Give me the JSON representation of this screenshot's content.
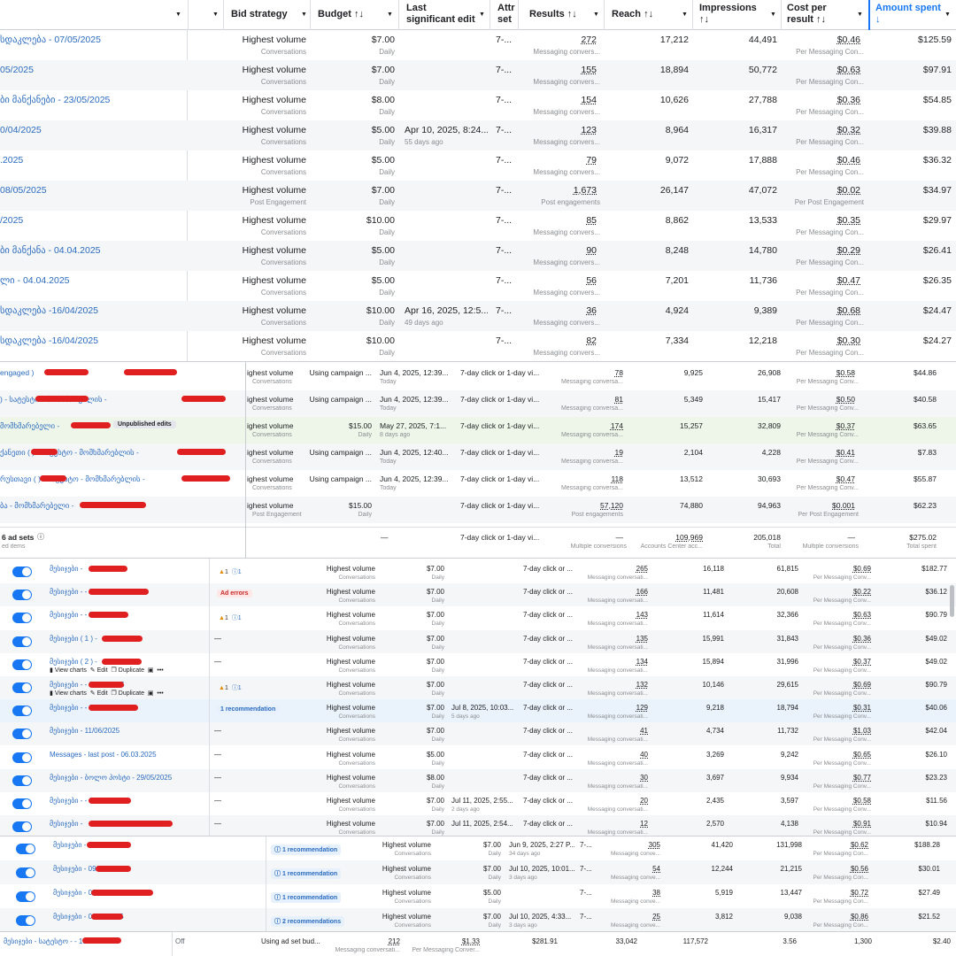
{
  "header": {
    "bid_strategy": "Bid strategy",
    "budget": "Budget ↑↓",
    "last_edit": "Last significant edit",
    "attribution": "Attr set",
    "results": "Results ↑↓",
    "reach": "Reach ↑↓",
    "impressions": "Impressions ↑↓",
    "cost_per_result": "Cost per result ↑↓",
    "amount_spent": "Amount spent ↓"
  },
  "section1": {
    "rows": [
      {
        "name": "სდაკლება - 07/05/2025",
        "bid": "Highest volume",
        "bid_sub": "Conversations",
        "budget": "$7.00",
        "budget_sub": "Daily",
        "edit": "",
        "edit_sub": "",
        "attr": "7-...",
        "results": "272",
        "results_sub": "Messaging convers...",
        "reach": "17,212",
        "impr": "44,491",
        "cpr": "$0.46",
        "cpr_sub": "Per Messaging Con...",
        "spent": "$125.59"
      },
      {
        "name": "05/2025",
        "bid": "Highest volume",
        "bid_sub": "Conversations",
        "budget": "$7.00",
        "budget_sub": "Daily",
        "edit": "",
        "edit_sub": "",
        "attr": "7-...",
        "results": "155",
        "results_sub": "Messaging convers...",
        "reach": "18,894",
        "impr": "50,772",
        "cpr": "$0.63",
        "cpr_sub": "Per Messaging Con...",
        "spent": "$97.91"
      },
      {
        "name": "ბი მანქანები - 23/05/2025",
        "bid": "Highest volume",
        "bid_sub": "Conversations",
        "budget": "$8.00",
        "budget_sub": "Daily",
        "edit": "",
        "edit_sub": "",
        "attr": "7-...",
        "results": "154",
        "results_sub": "Messaging convers...",
        "reach": "10,626",
        "impr": "27,788",
        "cpr": "$0.36",
        "cpr_sub": "Per Messaging Con...",
        "spent": "$54.85"
      },
      {
        "name": "0/04/2025",
        "bid": "Highest volume",
        "bid_sub": "Conversations",
        "budget": "$5.00",
        "budget_sub": "Daily",
        "edit": "Apr 10, 2025, 8:24...",
        "edit_sub": "55 days ago",
        "attr": "7-...",
        "results": "123",
        "results_sub": "Messaging convers...",
        "reach": "8,964",
        "impr": "16,317",
        "cpr": "$0.32",
        "cpr_sub": "Per Messaging Con...",
        "spent": "$39.88"
      },
      {
        "name": ".2025",
        "bid": "Highest volume",
        "bid_sub": "Conversations",
        "budget": "$5.00",
        "budget_sub": "Daily",
        "edit": "",
        "edit_sub": "",
        "attr": "7-...",
        "results": "79",
        "results_sub": "Messaging convers...",
        "reach": "9,072",
        "impr": "17,888",
        "cpr": "$0.46",
        "cpr_sub": "Per Messaging Con...",
        "spent": "$36.32"
      },
      {
        "name": "08/05/2025",
        "bid": "Highest volume",
        "bid_sub": "Post Engagement",
        "budget": "$7.00",
        "budget_sub": "Daily",
        "edit": "",
        "edit_sub": "",
        "attr": "7-...",
        "results": "1,673",
        "results_sub": "Post engagements",
        "reach": "26,147",
        "impr": "47,072",
        "cpr": "$0.02",
        "cpr_sub": "Per Post Engagement",
        "spent": "$34.97"
      },
      {
        "name": "/2025",
        "bid": "Highest volume",
        "bid_sub": "Conversations",
        "budget": "$10.00",
        "budget_sub": "Daily",
        "edit": "",
        "edit_sub": "",
        "attr": "7-...",
        "results": "85",
        "results_sub": "Messaging convers...",
        "reach": "8,862",
        "impr": "13,533",
        "cpr": "$0.35",
        "cpr_sub": "Per Messaging Con...",
        "spent": "$29.97"
      },
      {
        "name": "ბი მანქანა - 04.04.2025",
        "bid": "Highest volume",
        "bid_sub": "Conversations",
        "budget": "$5.00",
        "budget_sub": "Daily",
        "edit": "",
        "edit_sub": "",
        "attr": "7-...",
        "results": "90",
        "results_sub": "Messaging convers...",
        "reach": "8,248",
        "impr": "14,780",
        "cpr": "$0.29",
        "cpr_sub": "Per Messaging Con...",
        "spent": "$26.41"
      },
      {
        "name": "ლი - 04.04.2025",
        "bid": "Highest volume",
        "bid_sub": "Conversations",
        "budget": "$5.00",
        "budget_sub": "Daily",
        "edit": "",
        "edit_sub": "",
        "attr": "7-...",
        "results": "56",
        "results_sub": "Messaging convers...",
        "reach": "7,201",
        "impr": "11,736",
        "cpr": "$0.47",
        "cpr_sub": "Per Messaging Con...",
        "spent": "$26.35"
      },
      {
        "name": "სდაკლება -16/04/2025",
        "bid": "Highest volume",
        "bid_sub": "Conversations",
        "budget": "$10.00",
        "budget_sub": "Daily",
        "edit": "Apr 16, 2025, 12:5...",
        "edit_sub": "49 days ago",
        "attr": "7-...",
        "results": "36",
        "results_sub": "Messaging convers...",
        "reach": "4,924",
        "impr": "9,389",
        "cpr": "$0.68",
        "cpr_sub": "Per Messaging Con...",
        "spent": "$24.47"
      },
      {
        "name": "სდაკლება -16/04/2025",
        "bid": "Highest volume",
        "bid_sub": "Conversations",
        "budget": "$10.00",
        "budget_sub": "Daily",
        "edit": "",
        "edit_sub": "",
        "attr": "7-...",
        "results": "82",
        "results_sub": "Messaging convers...",
        "reach": "7,334",
        "impr": "12,218",
        "cpr": "$0.30",
        "cpr_sub": "Per Messaging Con...",
        "spent": "$24.27"
      }
    ]
  },
  "section2": {
    "rows": [
      {
        "name": "engaged )",
        "badge": "",
        "bid": "ighest volume",
        "bid_sub": "Conversations",
        "budget": "Using campaign ...",
        "budget_sub": "",
        "edit": "Jun 4, 2025, 12:39...",
        "edit_sub": "Today",
        "attr": "7-day click or 1-day vi...",
        "results": "78",
        "results_sub": "Messaging conversa...",
        "reach": "9,925",
        "impr": "26,908",
        "cpr": "$0.58",
        "cpr_sub": "Per Messaging Conv...",
        "spent": "$44.86"
      },
      {
        "name": ") - სატესტო - მომხმარებლის -",
        "badge": "",
        "bid": "ighest volume",
        "bid_sub": "Conversations",
        "budget": "Using campaign ...",
        "budget_sub": "",
        "edit": "Jun 4, 2025, 12:39...",
        "edit_sub": "Today",
        "attr": "7-day click or 1-day vi...",
        "results": "81",
        "results_sub": "Messaging conversa...",
        "reach": "5,349",
        "impr": "15,417",
        "cpr": "$0.50",
        "cpr_sub": "Per Messaging Conv...",
        "spent": "$40.58"
      },
      {
        "name": "მომხმარებელი -",
        "badge": "Unpublished edits",
        "bid": "ighest volume",
        "bid_sub": "Conversations",
        "budget": "$15.00",
        "budget_sub": "Daily",
        "edit": "May 27, 2025, 7:1...",
        "edit_sub": "8 days ago",
        "attr": "7-day click or 1-day vi...",
        "results": "174",
        "results_sub": "Messaging conversa...",
        "reach": "15,257",
        "impr": "32,809",
        "cpr": "$0.37",
        "cpr_sub": "Per Messaging Conv...",
        "spent": "$63.65"
      },
      {
        "name": "ქანეთი ( ) - სატესტო - მომხმარებლის -",
        "badge": "",
        "bid": "ighest volume",
        "bid_sub": "Conversations",
        "budget": "Using campaign ...",
        "budget_sub": "",
        "edit": "Jun 4, 2025, 12:40...",
        "edit_sub": "Today",
        "attr": "7-day click or 1-day vi...",
        "results": "19",
        "results_sub": "Messaging conversa...",
        "reach": "2,104",
        "impr": "4,228",
        "cpr": "$0.41",
        "cpr_sub": "Per Messaging Conv...",
        "spent": "$7.83"
      },
      {
        "name": "რუსთავი ( ) - სატესტო - მომხმარებლის -",
        "badge": "",
        "bid": "ighest volume",
        "bid_sub": "Conversations",
        "budget": "Using campaign ...",
        "budget_sub": "",
        "edit": "Jun 4, 2025, 12:39...",
        "edit_sub": "Today",
        "attr": "7-day click or 1-day vi...",
        "results": "118",
        "results_sub": "Messaging conversa...",
        "reach": "13,512",
        "impr": "30,693",
        "cpr": "$0.47",
        "cpr_sub": "Per Messaging Conv...",
        "spent": "$55.87"
      },
      {
        "name": "ბა - მომხმარებელი -",
        "badge": "",
        "bid": "ighest volume",
        "bid_sub": "Post Engagement",
        "budget": "$15.00",
        "budget_sub": "Daily",
        "edit": "",
        "edit_sub": "",
        "attr": "7-day click or 1-day vi...",
        "results": "57,120",
        "results_sub": "Post engagements",
        "reach": "74,880",
        "impr": "94,963",
        "cpr": "$0.001",
        "cpr_sub": "Per Post Engagement",
        "spent": "$62.23"
      }
    ],
    "total": {
      "label": "6 ad sets",
      "label_sub": "ed items",
      "edit": "—",
      "attr": "7-day click or 1-day vi...",
      "results": "—",
      "results_sub": "Multiple conversions",
      "reach": "109,969",
      "reach_sub": "Accounts Center acc...",
      "impr": "205,018",
      "impr_sub": "Total",
      "cpr": "—",
      "cpr_sub": "Multiple conversions",
      "spent": "$275.02",
      "spent_sub": "Total spent"
    }
  },
  "section3": {
    "rows": [
      {
        "name": "მესიჯები -",
        "status": "warn",
        "status_a": "1",
        "status_b": "1",
        "bid": "Highest volume",
        "bid_sub": "Conversations",
        "budget": "$7.00",
        "budget_sub": "Daily",
        "edit": "",
        "edit_sub": "",
        "attr": "7-day click or ...",
        "results": "265",
        "results_sub": "Messaging conversati...",
        "reach": "16,118",
        "impr": "61,815",
        "cpr": "$0.69",
        "cpr_sub": "Per Messaging Conv...",
        "spent": "$182.77",
        "actions": false
      },
      {
        "name": "მესიჯები - - 20/06/2025",
        "status": "err",
        "status_text": "Ad errors",
        "bid": "Highest volume",
        "bid_sub": "Conversations",
        "budget": "$7.00",
        "budget_sub": "Daily",
        "edit": "",
        "edit_sub": "",
        "attr": "7-day click or ...",
        "results": "166",
        "results_sub": "Messaging conversati...",
        "reach": "11,481",
        "impr": "20,608",
        "cpr": "$0.22",
        "cpr_sub": "Per Messaging Conv...",
        "spent": "$36.12",
        "actions": false
      },
      {
        "name": "მესიჯები - - 27/06/2025 -",
        "status": "warn",
        "status_a": "1",
        "status_b": "1",
        "bid": "Highest volume",
        "bid_sub": "Conversations",
        "budget": "$7.00",
        "budget_sub": "Daily",
        "edit": "",
        "edit_sub": "",
        "attr": "7-day click or ...",
        "results": "143",
        "results_sub": "Messaging conversati...",
        "reach": "11,614",
        "impr": "32,366",
        "cpr": "$0.63",
        "cpr_sub": "Per Messaging Conv...",
        "spent": "$90.79",
        "actions": false
      },
      {
        "name": "მესიჯები ( 1 ) -",
        "status": "dash",
        "bid": "Highest volume",
        "bid_sub": "Conversations",
        "budget": "$7.00",
        "budget_sub": "Daily",
        "edit": "",
        "edit_sub": "",
        "attr": "7-day click or ...",
        "results": "135",
        "results_sub": "Messaging conversati...",
        "reach": "15,991",
        "impr": "31,843",
        "cpr": "$0.36",
        "cpr_sub": "Per Messaging Conv...",
        "spent": "$49.02",
        "actions": false
      },
      {
        "name": "მესიჯები ( 2 ) -",
        "status": "dash",
        "bid": "Highest volume",
        "bid_sub": "Conversations",
        "budget": "$7.00",
        "budget_sub": "Daily",
        "edit": "",
        "edit_sub": "",
        "attr": "7-day click or ...",
        "results": "134",
        "results_sub": "Messaging conversati...",
        "reach": "15,894",
        "impr": "31,996",
        "cpr": "$0.37",
        "cpr_sub": "Per Messaging Conv...",
        "spent": "$49.02",
        "actions": true
      },
      {
        "name": "მესიჯები - - 27/06/2025",
        "status": "warn",
        "status_a": "1",
        "status_b": "1",
        "bid": "Highest volume",
        "bid_sub": "Conversations",
        "budget": "$7.00",
        "budget_sub": "Daily",
        "edit": "",
        "edit_sub": "",
        "attr": "7-day click or ...",
        "results": "132",
        "results_sub": "Messaging conversati...",
        "reach": "10,146",
        "impr": "29,615",
        "cpr": "$0.69",
        "cpr_sub": "Per Messaging Conv...",
        "spent": "$90.79",
        "actions": true
      },
      {
        "name": "მესიჯები - - 07/07/2025",
        "status": "rec",
        "status_text": "1 recommendation",
        "bid": "Highest volume",
        "bid_sub": "Conversations",
        "budget": "$7.00",
        "budget_sub": "Daily",
        "edit": "Jul 8, 2025, 10:03...",
        "edit_sub": "5 days ago",
        "attr": "7-day click or ...",
        "results": "129",
        "results_sub": "Messaging conversati...",
        "reach": "9,218",
        "impr": "18,794",
        "cpr": "$0.31",
        "cpr_sub": "Per Messaging Conv...",
        "spent": "$40.06",
        "actions": false
      },
      {
        "name": "მესიჯები - 11/06/2025",
        "status": "dash",
        "bid": "Highest volume",
        "bid_sub": "Conversations",
        "budget": "$7.00",
        "budget_sub": "Daily",
        "edit": "",
        "edit_sub": "",
        "attr": "7-day click or ...",
        "results": "41",
        "results_sub": "Messaging conversati...",
        "reach": "4,734",
        "impr": "11,732",
        "cpr": "$1.03",
        "cpr_sub": "Per Messaging Conv...",
        "spent": "$42.04",
        "actions": false
      },
      {
        "name": "Messages - last post - 06.03.2025",
        "status": "dash",
        "bid": "Highest volume",
        "bid_sub": "Conversations",
        "budget": "$5.00",
        "budget_sub": "Daily",
        "edit": "",
        "edit_sub": "",
        "attr": "7-day click or ...",
        "results": "40",
        "results_sub": "Messaging conversati...",
        "reach": "3,269",
        "impr": "9,242",
        "cpr": "$0.65",
        "cpr_sub": "Per Messaging Conv...",
        "spent": "$26.10",
        "actions": false
      },
      {
        "name": "მესიჯები - ბოლო პოსტი - 29/05/2025",
        "status": "dash",
        "bid": "Highest volume",
        "bid_sub": "Conversations",
        "budget": "$8.00",
        "budget_sub": "Daily",
        "edit": "",
        "edit_sub": "",
        "attr": "7-day click or ...",
        "results": "30",
        "results_sub": "Messaging conversati...",
        "reach": "3,697",
        "impr": "9,934",
        "cpr": "$0.77",
        "cpr_sub": "Per Messaging Conv...",
        "spent": "$23.23",
        "actions": false
      },
      {
        "name": "მესიჯები - - 11/07/2025",
        "status": "dash",
        "bid": "Highest volume",
        "bid_sub": "Conversations",
        "budget": "$7.00",
        "budget_sub": "Daily",
        "edit": "Jul 11, 2025, 2:55...",
        "edit_sub": "2 days ago",
        "attr": "7-day click or ...",
        "results": "20",
        "results_sub": "Messaging conversati...",
        "reach": "2,435",
        "impr": "3,597",
        "cpr": "$0.58",
        "cpr_sub": "Per Messaging Conv...",
        "spent": "$11.56",
        "actions": false
      },
      {
        "name": "მესიჯები -",
        "status": "dash",
        "bid": "Highest volume",
        "bid_sub": "Conversations",
        "budget": "$7.00",
        "budget_sub": "Daily",
        "edit": "Jul 11, 2025, 2:54...",
        "edit_sub": "",
        "attr": "7-day click or ...",
        "results": "12",
        "results_sub": "Messaging conversati...",
        "reach": "2,570",
        "impr": "4,138",
        "cpr": "$0.91",
        "cpr_sub": "Per Messaging Conv...",
        "spent": "$10.94",
        "actions": false
      }
    ],
    "actions": {
      "view_charts": "View charts",
      "edit": "Edit",
      "duplicate": "Duplicate"
    }
  },
  "section4": {
    "rows": [
      {
        "name": "მესიჯები - - 02/06/2025",
        "rec": "1 recommendation",
        "bid": "Highest volume",
        "bid_sub": "Conversations",
        "budget": "$7.00",
        "budget_sub": "Daily",
        "edit": "Jun 9, 2025, 2:27 P...",
        "edit_sub": "34 days ago",
        "attr": "7-...",
        "results": "305",
        "results_sub": "Messaging conve...",
        "reach": "41,420",
        "impr": "131,998",
        "cpr": "$0.62",
        "cpr_sub": "Per Messaging Con...",
        "spent": "$188.28"
      },
      {
        "name": "მესიჯები - 09/07/2025",
        "rec": "1 recommendation",
        "bid": "Highest volume",
        "bid_sub": "Conversations",
        "budget": "$7.00",
        "budget_sub": "Daily",
        "edit": "Jul 10, 2025, 10:01...",
        "edit_sub": "3 days ago",
        "attr": "7-...",
        "results": "54",
        "results_sub": "Messaging conve...",
        "reach": "12,244",
        "impr": "21,215",
        "cpr": "$0.56",
        "cpr_sub": "Per Messaging Con...",
        "spent": "$30.01"
      },
      {
        "name": "მესიჯები - 03/07/2025",
        "rec": "1 recommendation",
        "bid": "Highest volume",
        "bid_sub": "Conversations",
        "budget": "$5.00",
        "budget_sub": "Daily",
        "edit": "",
        "edit_sub": "",
        "attr": "7-...",
        "results": "38",
        "results_sub": "Messaging conve...",
        "reach": "5,919",
        "impr": "13,447",
        "cpr": "$0.72",
        "cpr_sub": "Per Messaging Con...",
        "spent": "$27.49"
      },
      {
        "name": "მესიჯები - 09/07/2025",
        "rec": "2 recommendations",
        "bid": "Highest volume",
        "bid_sub": "Conversations",
        "budget": "$7.00",
        "budget_sub": "Daily",
        "edit": "Jul 10, 2025, 4:33...",
        "edit_sub": "3 days ago",
        "attr": "7-...",
        "results": "25",
        "results_sub": "Messaging conve...",
        "reach": "3,812",
        "impr": "9,038",
        "cpr": "$0.86",
        "cpr_sub": "Per Messaging Con...",
        "spent": "$21.52"
      }
    ]
  },
  "section5": {
    "name": "მესიჯები - სატესტო - - 19/06/20...",
    "status": "Off",
    "budget": "Using ad set bud...",
    "results": "212",
    "results_sub": "Messaging conversati...",
    "cpr": "$1.33",
    "cpr_sub": "Per Messaging Conver...",
    "spent": "$281.91",
    "reach": "33,042",
    "impr": "117,572",
    "freq": "3.56",
    "v2": "1,300",
    "v3": "$2.40"
  }
}
